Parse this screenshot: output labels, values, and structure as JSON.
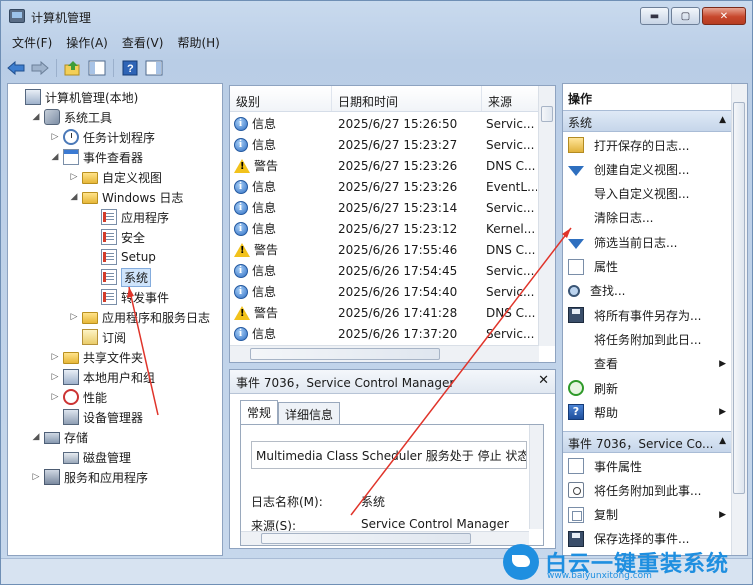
{
  "window": {
    "title": "计算机管理",
    "min": "▬",
    "max": "▢",
    "close": "✕"
  },
  "menu": [
    "文件(F)",
    "操作(A)",
    "查看(V)",
    "帮助(H)"
  ],
  "toolbar": {
    "icons": [
      "back-icon",
      "forward-icon",
      "up-icon",
      "show-hide-tree-icon",
      "help-icon",
      "show-hide-action-icon"
    ]
  },
  "tree": [
    {
      "label": "计算机管理(本地)",
      "icon": "computer-icon",
      "level": 0,
      "exp": ""
    },
    {
      "label": "系统工具",
      "icon": "tools-icon",
      "level": 1,
      "exp": "◢"
    },
    {
      "label": "任务计划程序",
      "icon": "clock-icon",
      "level": 2,
      "exp": "▷"
    },
    {
      "label": "事件查看器",
      "icon": "event-viewer-icon",
      "level": 2,
      "exp": "◢"
    },
    {
      "label": "自定义视图",
      "icon": "folder-icon",
      "level": 3,
      "exp": "▷"
    },
    {
      "label": "Windows 日志",
      "icon": "folder-icon",
      "level": 3,
      "exp": "◢"
    },
    {
      "label": "应用程序",
      "icon": "log-icon",
      "level": 4,
      "exp": ""
    },
    {
      "label": "安全",
      "icon": "log-icon",
      "level": 4,
      "exp": ""
    },
    {
      "label": "Setup",
      "icon": "log-icon",
      "level": 4,
      "exp": ""
    },
    {
      "label": "系统",
      "icon": "log-icon",
      "level": 4,
      "exp": "",
      "selected": true
    },
    {
      "label": "转发事件",
      "icon": "log-icon",
      "level": 4,
      "exp": ""
    },
    {
      "label": "应用程序和服务日志",
      "icon": "folder-icon",
      "level": 3,
      "exp": "▷"
    },
    {
      "label": "订阅",
      "icon": "subscription-icon",
      "level": 3,
      "exp": ""
    },
    {
      "label": "共享文件夹",
      "icon": "folder-icon",
      "level": 2,
      "exp": "▷"
    },
    {
      "label": "本地用户和组",
      "icon": "users-icon",
      "level": 2,
      "exp": "▷"
    },
    {
      "label": "性能",
      "icon": "performance-icon",
      "level": 2,
      "exp": "▷"
    },
    {
      "label": "设备管理器",
      "icon": "device-icon",
      "level": 2,
      "exp": ""
    },
    {
      "label": "存储",
      "icon": "storage-icon",
      "level": 1,
      "exp": "◢"
    },
    {
      "label": "磁盘管理",
      "icon": "disk-icon",
      "level": 2,
      "exp": ""
    },
    {
      "label": "服务和应用程序",
      "icon": "services-icon",
      "level": 1,
      "exp": "▷"
    }
  ],
  "events": {
    "columns": [
      "级别",
      "日期和时间",
      "来源"
    ],
    "rows": [
      {
        "level": "信息",
        "icon": "info",
        "time": "2025/6/27 15:26:50",
        "source": "Servic..."
      },
      {
        "level": "信息",
        "icon": "info",
        "time": "2025/6/27 15:23:27",
        "source": "Servic..."
      },
      {
        "level": "警告",
        "icon": "warn",
        "time": "2025/6/27 15:23:26",
        "source": "DNS C..."
      },
      {
        "level": "信息",
        "icon": "info",
        "time": "2025/6/27 15:23:26",
        "source": "EventL..."
      },
      {
        "level": "信息",
        "icon": "info",
        "time": "2025/6/27 15:23:14",
        "source": "Servic..."
      },
      {
        "level": "信息",
        "icon": "info",
        "time": "2025/6/27 15:23:12",
        "source": "Kernel..."
      },
      {
        "level": "警告",
        "icon": "warn",
        "time": "2025/6/26 17:55:46",
        "source": "DNS C..."
      },
      {
        "level": "信息",
        "icon": "info",
        "time": "2025/6/26 17:54:45",
        "source": "Servic..."
      },
      {
        "level": "信息",
        "icon": "info",
        "time": "2025/6/26 17:54:40",
        "source": "Servic..."
      },
      {
        "level": "警告",
        "icon": "warn",
        "time": "2025/6/26 17:41:28",
        "source": "DNS C..."
      },
      {
        "level": "信息",
        "icon": "info",
        "time": "2025/6/26 17:37:20",
        "source": "Servic..."
      }
    ]
  },
  "detail": {
    "title": "事件 7036，Service Control Manager",
    "close": "✕",
    "tabs": [
      "常规",
      "详细信息"
    ],
    "description": "Multimedia Class Scheduler 服务处于 停止 状态",
    "fields": [
      {
        "key": "日志名称(M):",
        "value": "系统"
      },
      {
        "key": "来源(S):",
        "value": "Service Control Manager"
      }
    ]
  },
  "actions": {
    "header": "操作",
    "group1": "系统",
    "items1": [
      {
        "label": "打开保存的日志...",
        "icon": "open-icon"
      },
      {
        "label": "创建自定义视图...",
        "icon": "filter-icon"
      },
      {
        "label": "导入自定义视图...",
        "icon": ""
      },
      {
        "label": "清除日志...",
        "icon": ""
      },
      {
        "label": "筛选当前日志...",
        "icon": "filter-icon"
      },
      {
        "label": "属性",
        "icon": "properties-icon"
      },
      {
        "label": "查找...",
        "icon": "find-icon"
      },
      {
        "label": "将所有事件另存为...",
        "icon": "save-icon"
      },
      {
        "label": "将任务附加到此日...",
        "icon": ""
      },
      {
        "label": "查看",
        "icon": "",
        "submenu": true
      },
      {
        "label": "刷新",
        "icon": "refresh-icon"
      },
      {
        "label": "帮助",
        "icon": "help-icon",
        "submenu": true
      }
    ],
    "group2": "事件 7036，Service Co...",
    "items2": [
      {
        "label": "事件属性",
        "icon": "properties-icon"
      },
      {
        "label": "将任务附加到此事...",
        "icon": "task-icon"
      },
      {
        "label": "复制",
        "icon": "copy-icon",
        "submenu": true
      },
      {
        "label": "保存选择的事件...",
        "icon": "save-icon"
      }
    ]
  },
  "watermark": {
    "brand": "白云一键重装系统",
    "url": "www.baiyunxitong.com"
  },
  "colors": {
    "annotation": "#e0342a",
    "selection": "#cfe4fb",
    "accent": "#1f8fe0"
  }
}
